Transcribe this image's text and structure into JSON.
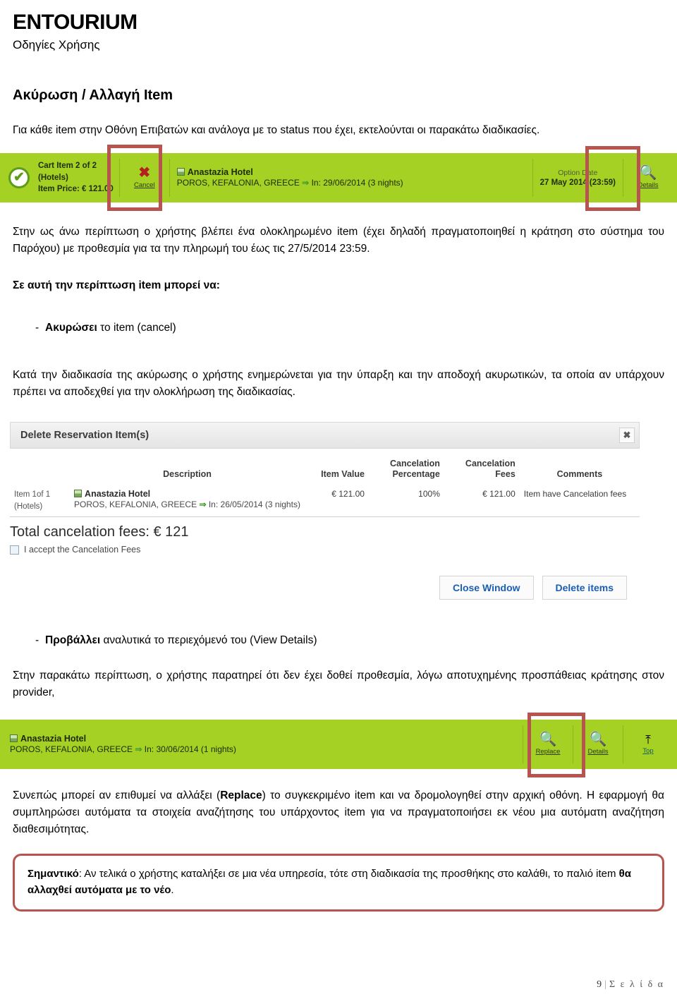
{
  "header": {
    "title": "ENTOURIUM",
    "subtitle": "Οδηγίες Χρήσης"
  },
  "section": {
    "title": "Ακύρωση / Αλλαγή Item"
  },
  "paragraphs": {
    "intro": "Για κάθε item στην Οθόνη Επιβατών και ανάλογα με το status που έχει, εκτελούνται οι παρακάτω διαδικασίες.",
    "after_cart_bar": "Στην ως άνω περίπτωση ο χρήστης βλέπει ένα ολοκληρωμένο item (έχει δηλαδή πραγματοποιηθεί η κράτηση στο σύστημα του Παρόχου) με προθεσμία για τα την πληρωμή του έως τις 27/5/2014 23:59.",
    "options_lead": "Σε αυτή την περίπτωση item μπορεί να:",
    "cancel_desc": "Κατά την διαδικασία της ακύρωσης ο χρήστης ενημερώνεται για την ύπαρξη και την αποδοχή ακυρωτικών, τα οποία αν υπάρχουν πρέπει να αποδεχθεί για την ολοκλήρωση της διαδικασίας.",
    "details_desc": "Στην παρακάτω περίπτωση, ο χρήστης παρατηρεί ότι δεν έχει δοθεί προθεσμία, λόγω αποτυχημένης προσπάθειας κράτησης στον provider,",
    "replace_desc_1": "Συνεπώς μπορεί αν επιθυμεί να αλλάξει (",
    "replace_desc_bold": "Replace",
    "replace_desc_2": ") το συγκεκριμένο item και  να δρομολογηθεί στην αρχική οθόνη. Η εφαρμογή θα συμπληρώσει αυτόματα τα στοιχεία αναζήτησης του υπάρχοντος item για να πραγματοποιήσει εκ νέου μια αυτόματη αναζήτηση διαθεσιμότητας."
  },
  "bullets": [
    {
      "dash": "-",
      "bold": "Ακυρώσει",
      "rest": " το item (cancel)"
    },
    {
      "dash": "-",
      "bold": "Προβάλλει",
      "rest": " αναλυτικά το περιεχόμενό του (View Details)"
    }
  ],
  "cart_bar": {
    "status_icon": "check-circle-icon",
    "item_line_1": "Cart Item 2 of 2",
    "item_line_2": "(Hotels)",
    "item_line_3_label": "Item Price",
    "item_line_3_value": ": € 121.00",
    "cancel_icon": "x-mark-icon",
    "cancel_label": "Cancel",
    "hotel_icon": "hotel-icon",
    "hotel_name": "Anastazia Hotel",
    "hotel_location": "POROS, KEFALONIA, GREECE",
    "arrow": "⇒",
    "hotel_dates": "In: 29/06/2014 (3 nights)",
    "option_date_label": "Option Date",
    "option_date_value": "27 May 2014 (23:59)",
    "details_icon": "magnifier-icon",
    "details_label": "Details",
    "green": "#a5d024",
    "highlight_color": "#b8544f"
  },
  "delete_dialog": {
    "title": "Delete Reservation Item(s)",
    "close_icon": "close-icon",
    "columns": [
      "",
      "Description",
      "Item Value",
      "Cancelation Percentage",
      "Cancelation Fees",
      "Comments"
    ],
    "rows": [
      {
        "index_line_1": "Item 1of 1",
        "index_line_2": "(Hotels)",
        "hotel_icon": "hotel-icon",
        "hotel_name": "Anastazia Hotel",
        "hotel_location": "POROS, KEFALONIA, GREECE",
        "arrow": "⇒",
        "hotel_dates": "In: 26/05/2014 (3 nights)",
        "item_value": "€ 121.00",
        "cancelation_percentage": "100%",
        "cancelation_fees": "€ 121.00",
        "comments": "Item have Cancelation fees"
      }
    ],
    "total_label": "Total cancelation fees: ",
    "total_value": "€ 121",
    "accept_checkbox_label": "I accept the Cancelation Fees",
    "close_window_button": "Close Window",
    "delete_items_button": "Delete items"
  },
  "replace_bar": {
    "hotel_icon": "hotel-icon",
    "hotel_name": "Anastazia Hotel",
    "hotel_location": "POROS, KEFALONIA, GREECE",
    "arrow": "⇒",
    "hotel_dates": "In: 30/06/2014 (1 nights)",
    "actions": [
      {
        "icon": "magnifier-icon",
        "label": "Replace"
      },
      {
        "icon": "magnifier-icon",
        "label": "Details"
      },
      {
        "icon": "arrow-up-to-line-icon",
        "label": "Top"
      }
    ],
    "green": "#a5d024",
    "highlight_color": "#b8544f"
  },
  "note": {
    "bold_lead": "Σημαντικό",
    "text_1": ": Αν τελικά ο χρήστης καταλήξει σε μια νέα υπηρεσία, τότε στη διαδικασία της προσθήκης στο καλάθι, το παλιό item ",
    "bold_tail": "θα αλλαχθεί αυτόματα με το νέο",
    "text_2": "."
  },
  "footer": {
    "page_number": "9",
    "separator": "|",
    "word": "Σ ε λ ί δ α"
  }
}
